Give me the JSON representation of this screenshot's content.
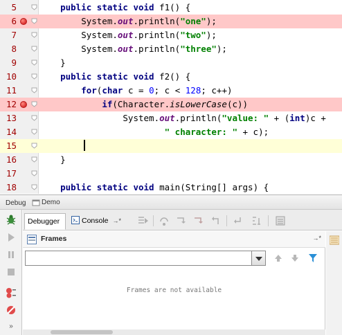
{
  "editor": {
    "lines": [
      {
        "number": "5",
        "tokens": [
          {
            "t": "    "
          },
          {
            "t": "public static void",
            "c": "kw"
          },
          {
            "t": " f1() {"
          }
        ]
      },
      {
        "number": "6",
        "tokens": [
          {
            "t": "        System."
          },
          {
            "t": "out",
            "c": "fld"
          },
          {
            "t": ".println("
          },
          {
            "t": "\"one\"",
            "c": "str"
          },
          {
            "t": ");"
          }
        ]
      },
      {
        "number": "7",
        "tokens": [
          {
            "t": "        System."
          },
          {
            "t": "out",
            "c": "fld"
          },
          {
            "t": ".println("
          },
          {
            "t": "\"two\"",
            "c": "str"
          },
          {
            "t": ");"
          }
        ]
      },
      {
        "number": "8",
        "tokens": [
          {
            "t": "        System."
          },
          {
            "t": "out",
            "c": "fld"
          },
          {
            "t": ".println("
          },
          {
            "t": "\"three\"",
            "c": "str"
          },
          {
            "t": ");"
          }
        ]
      },
      {
        "number": "9",
        "tokens": [
          {
            "t": "    }"
          }
        ]
      },
      {
        "number": "10",
        "tokens": [
          {
            "t": "    "
          },
          {
            "t": "public static void",
            "c": "kw"
          },
          {
            "t": " f2() {"
          }
        ]
      },
      {
        "number": "11",
        "tokens": [
          {
            "t": "        "
          },
          {
            "t": "for",
            "c": "kw"
          },
          {
            "t": "("
          },
          {
            "t": "char",
            "c": "kw"
          },
          {
            "t": " c = "
          },
          {
            "t": "0",
            "c": "num"
          },
          {
            "t": "; c < "
          },
          {
            "t": "128",
            "c": "num"
          },
          {
            "t": "; c++)"
          }
        ]
      },
      {
        "number": "12",
        "tokens": [
          {
            "t": "            "
          },
          {
            "t": "if",
            "c": "kw"
          },
          {
            "t": "(Character."
          },
          {
            "t": "isLowerCase",
            "c": "st"
          },
          {
            "t": "(c))"
          }
        ]
      },
      {
        "number": "13",
        "tokens": [
          {
            "t": "                System."
          },
          {
            "t": "out",
            "c": "fld"
          },
          {
            "t": ".println("
          },
          {
            "t": "\"value: \"",
            "c": "str"
          },
          {
            "t": " + ("
          },
          {
            "t": "int",
            "c": "kw"
          },
          {
            "t": ")c +"
          }
        ]
      },
      {
        "number": "14",
        "tokens": [
          {
            "t": "                        "
          },
          {
            "t": "\" character: \"",
            "c": "str"
          },
          {
            "t": " + c);"
          }
        ]
      },
      {
        "number": "15",
        "tokens": [
          {
            "t": ""
          }
        ]
      },
      {
        "number": "16",
        "tokens": [
          {
            "t": "    }"
          }
        ]
      },
      {
        "number": "17",
        "tokens": [
          {
            "t": ""
          }
        ]
      },
      {
        "number": "18",
        "tokens": [
          {
            "t": "    "
          },
          {
            "t": "public static void",
            "c": "kw"
          },
          {
            "t": " main(String[] args) {"
          }
        ]
      }
    ],
    "breakpoint_lines": [
      "6",
      "12"
    ],
    "caret_line": "15"
  },
  "debug": {
    "header_label": "Debug",
    "run_config": "Demo",
    "tabs": [
      {
        "label": "Debugger"
      },
      {
        "label": "Console"
      }
    ],
    "console_suffix": "→*",
    "frames": {
      "title": "Frames",
      "pin": "→*",
      "selected_thread": "",
      "empty_message": "Frames are not available"
    }
  },
  "colors": {
    "breakpoint_line": "#ffc8c8",
    "caret_line": "#ffffd7",
    "keyword": "#000080",
    "string": "#008000",
    "field": "#660e7a",
    "number": "#0000ff",
    "line_number": "#a00000"
  }
}
